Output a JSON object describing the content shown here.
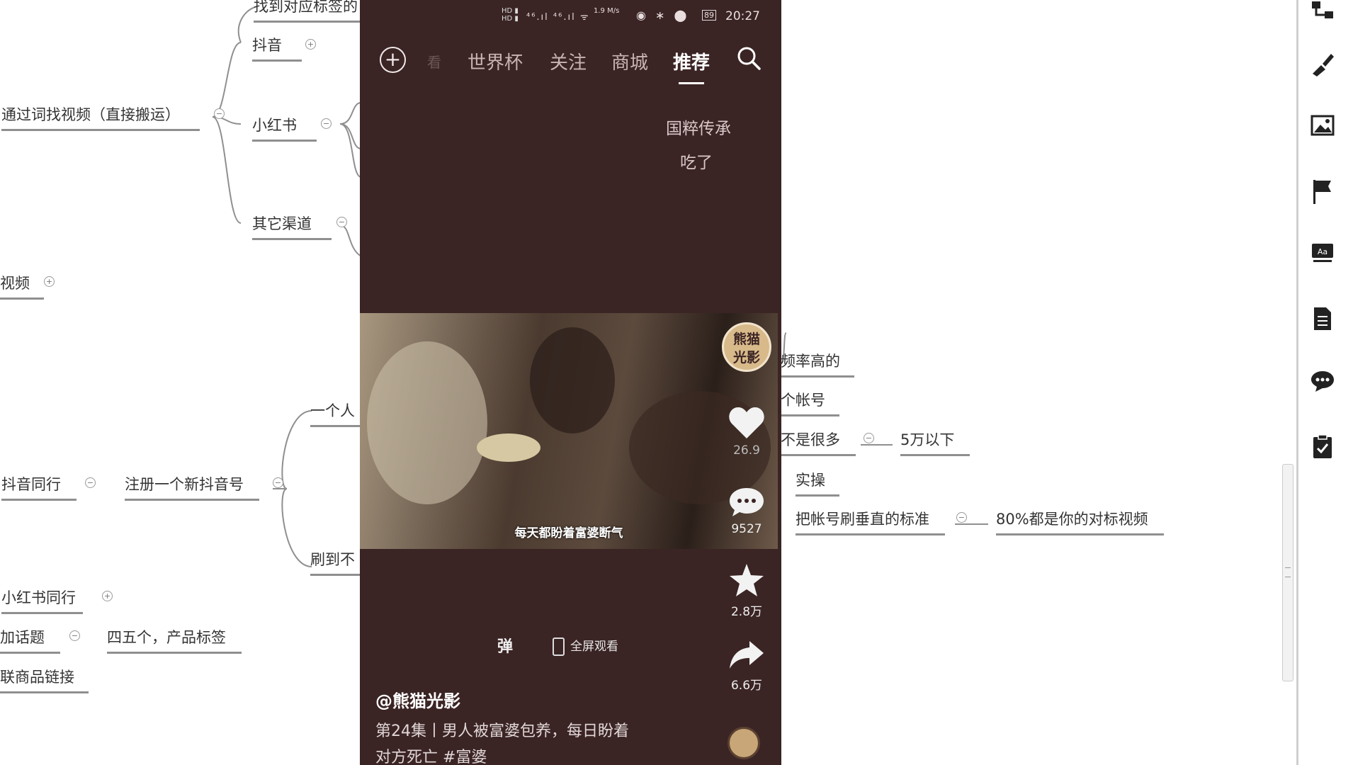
{
  "mindmap": {
    "nodes": {
      "top_cut": "找到对应标签的",
      "douyin": "抖音",
      "search_repost": "通过词找视频（直接搬运）",
      "xiaohongshu": "小红书",
      "other_channels": "其它渠道",
      "video": "视频",
      "one_person": "一个人",
      "douyin_peers": "抖音同行",
      "register_new": "注册一个新抖音号",
      "brush_to": "刷到不",
      "xhs_peers": "小红书同行",
      "add_topic": "加话题",
      "four_five": "四五个，产品标签",
      "link_goods": "联商品链接",
      "high_freq": "频率高的",
      "one_account": "个帐号",
      "not_many": "不是很多",
      "under_50k": "5万以下",
      "practice": "实操",
      "vertical_standard": "把帐号刷垂直的标准",
      "eighty_percent": "80%都是你的对标视频"
    }
  },
  "phone": {
    "status": {
      "time": "20:27",
      "battery": "89",
      "speed": "1.9 M/s"
    },
    "tabs": [
      "世界杯",
      "关注",
      "商城",
      "推荐"
    ],
    "active_tab": "推荐",
    "overlay_line1": "国粹传承",
    "overlay_line2": "吃了",
    "avatar_text1": "熊猫",
    "avatar_text2": "光影",
    "likes": "26.9",
    "comments": "9527",
    "favorites": "2.8万",
    "shares": "6.6万",
    "video_caption": "每天都盼着富婆断气",
    "danmu": "弹",
    "fullscreen_label": "全屏观看",
    "author": "@熊猫光影",
    "description_line1": "第24集丨男人被富婆包养，每日盼着",
    "description_line2": "对方死亡 #富婆"
  },
  "toolbar": {
    "icons": [
      "structure-icon",
      "brush-icon",
      "image-icon",
      "flag-icon",
      "text-style-icon",
      "note-icon",
      "comment-icon",
      "task-icon"
    ]
  }
}
